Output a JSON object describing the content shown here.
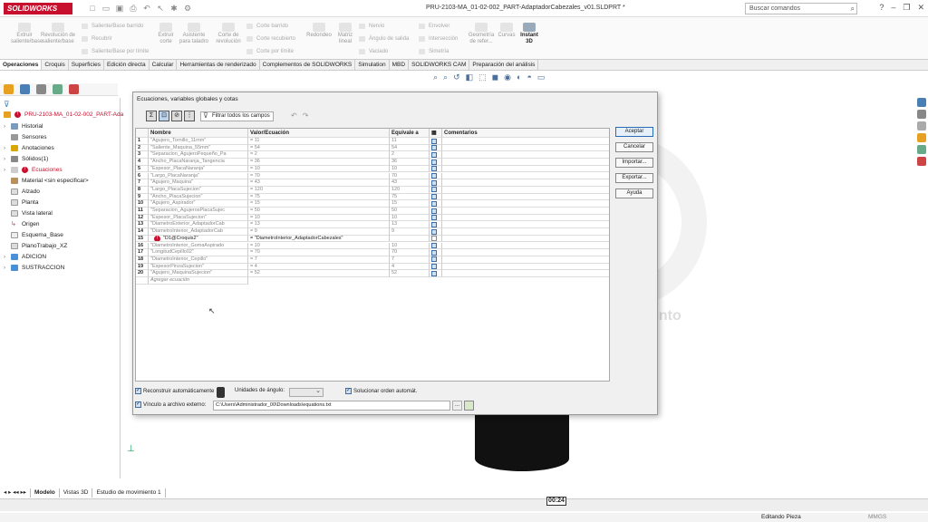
{
  "app": {
    "title": "SOLIDWORKS",
    "document": "PRU-2103-MA_01-02-002_PART-AdaptadorCabezales_v01.SLDPRT *",
    "search_placeholder": "Buscar comandos"
  },
  "ribbon": {
    "big": [
      "Extruir saliente/base",
      "Revolución de saliente/base",
      "Extruir corte",
      "Asistente para taladro",
      "Corte de revolución",
      "Redondeo",
      "Matriz lineal",
      "Geometría de refer...",
      "Curvas",
      "Instant 3D"
    ],
    "small": [
      "Saliente/Base barrido",
      "Recubrir",
      "Saliente/Base por límite",
      "Corte barrido",
      "Corte recubierto",
      "Corte por límite",
      "Nervio",
      "Ángulo de salida",
      "Vaciado",
      "Envolver",
      "Intersección",
      "Simetría"
    ]
  },
  "tabs": [
    "Operaciones",
    "Croquis",
    "Superficies",
    "Edición directa",
    "Calcular",
    "Herramientas de renderizado",
    "Complementos de SOLIDWORKS",
    "Simulation",
    "MBD",
    "SOLIDWORKS CAM",
    "Preparación del análisis"
  ],
  "tree": {
    "root": "PRU-2103-MA_01-02-002_PART-Ada",
    "items": [
      "Historial",
      "Sensores",
      "Anotaciones",
      "Sólidos(1)",
      "Ecuaciones",
      "Material <sin especificar>",
      "Alzado",
      "Planta",
      "Vista lateral",
      "Origen",
      "Esquema_Base",
      "PlanoTrabajo_XZ",
      "ADICION",
      "SUSTRACCION"
    ]
  },
  "dialog": {
    "title": "Ecuaciones, variables globales y cotas",
    "filter_label": "Filtrar todos los campos",
    "headers": [
      "Nombre",
      "Valor/Ecuación",
      "Equivale a",
      "Comentarios"
    ],
    "rows": [
      {
        "n": "1",
        "name": "\"Agujero_Tornillo_11mm\"",
        "val": "= 11",
        "eq": "11",
        "chk": true
      },
      {
        "n": "2",
        "name": "\"Saliente_Maquina_55mm\"",
        "val": "= 54",
        "eq": "54",
        "chk": true
      },
      {
        "n": "3",
        "name": "\"Separacion_AgujeroPequeño_Pa",
        "val": "= 2",
        "eq": "2",
        "chk": true
      },
      {
        "n": "4",
        "name": "\"Ancho_PlacaNaranja_Tangencia",
        "val": "= 36",
        "eq": "36",
        "chk": true
      },
      {
        "n": "5",
        "name": "\"Espesor_PlacaNaranja\"",
        "val": "= 10",
        "eq": "10",
        "chk": true
      },
      {
        "n": "6",
        "name": "\"Largo_PlacaNaranja\"",
        "val": "= 70",
        "eq": "70",
        "chk": true
      },
      {
        "n": "7",
        "name": "\"Agujero_Maquina\"",
        "val": "= 43",
        "eq": "43",
        "chk": true
      },
      {
        "n": "8",
        "name": "\"Largo_PlacaSujecion\"",
        "val": "= 120",
        "eq": "120",
        "chk": true
      },
      {
        "n": "9",
        "name": "\"Ancho_PlacaSujecion\"",
        "val": "= 75",
        "eq": "75",
        "chk": true
      },
      {
        "n": "10",
        "name": "\"Agujero_Aspirador\"",
        "val": "= 15",
        "eq": "15",
        "chk": true
      },
      {
        "n": "11",
        "name": "\"Separacion_AgujerosPlacaSujec",
        "val": "= 50",
        "eq": "50",
        "chk": true
      },
      {
        "n": "12",
        "name": "\"Espesor_PlacaSujecion\"",
        "val": "= 10",
        "eq": "10",
        "chk": true
      },
      {
        "n": "13",
        "name": "\"DiametroExterior_AdaptadorCab",
        "val": "= 13",
        "eq": "13",
        "chk": true
      },
      {
        "n": "14",
        "name": "\"DiametroInterior_AdaptadorCab",
        "val": "= 9",
        "eq": "9",
        "chk": true
      },
      {
        "n": "15",
        "name": "\"D1@Croquis2\"",
        "val": "= \"DiametroInterior_AdaptadorCabezales\"",
        "eq": "",
        "chk": false,
        "error": true
      },
      {
        "n": "16",
        "name": "\"DiametroInterior_GomaAspirado",
        "val": "= 10",
        "eq": "10",
        "chk": true
      },
      {
        "n": "17",
        "name": "\"LongitudCepillo02\"",
        "val": "= 70",
        "eq": "70",
        "chk": true
      },
      {
        "n": "18",
        "name": "\"DiametroInterior_Cepillo\"",
        "val": "= 7",
        "eq": "7",
        "chk": true
      },
      {
        "n": "19",
        "name": "\"EspesorPinzaSujecion\"",
        "val": "= 4",
        "eq": "4",
        "chk": true
      },
      {
        "n": "20",
        "name": "\"Agujero_MaquinaSujecion\"",
        "val": "= 52",
        "eq": "52",
        "chk": true
      }
    ],
    "add_placeholder": "Agregar ecuación",
    "buttons": [
      "Aceptar",
      "Cancelar",
      "Importar...",
      "Exportar...",
      "Ayuda"
    ],
    "auto_rebuild": "Reconstruir automáticamente",
    "angle_units": "Unidades de ángulo:",
    "auto_solve": "Solucionar orden automát.",
    "ext_link": "Vínculo a archivo externo:",
    "ext_path": "C:\\Users\\Administrador_00\\Downloads\\equations.txt",
    "browse": "..."
  },
  "bottom_tabs": [
    "Modelo",
    "Vistas 3D",
    "Estudio de movimiento 1"
  ],
  "status": {
    "edit": "Editando Pieza",
    "units": "MMGS"
  },
  "timer": "00:24",
  "watermark": "ento"
}
